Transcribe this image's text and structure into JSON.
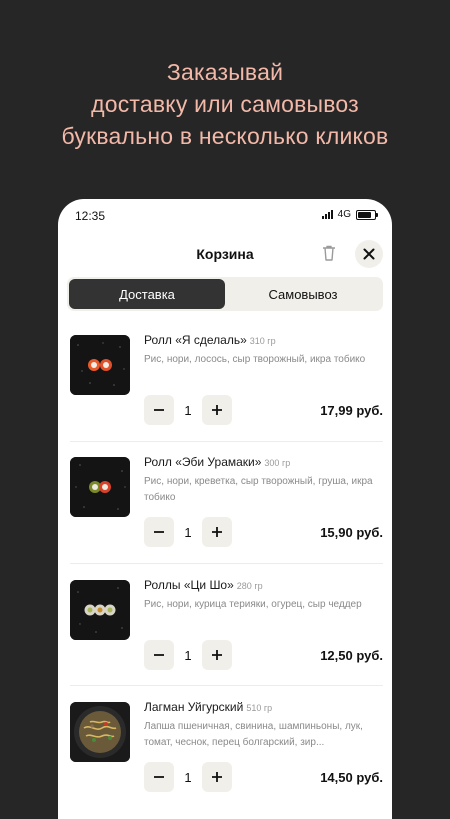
{
  "promo": {
    "line1": "Заказывай",
    "line2": "доставку или самовывоз",
    "line3": "буквально в несколько кликов",
    "color": "#f2b8a8"
  },
  "status_bar": {
    "time": "12:35",
    "network": "4G"
  },
  "cart": {
    "title": "Корзина",
    "icons": {
      "delete": "trash-icon",
      "close": "close-icon"
    },
    "tabs": [
      {
        "label": "Доставка",
        "active": true
      },
      {
        "label": "Самовывоз",
        "active": false
      }
    ],
    "items": [
      {
        "name": "Ролл «Я сделаль»",
        "weight": "310 гр",
        "description": "Рис, нори, лосось, сыр творожный, икра тобико",
        "quantity": "1",
        "price": "17,99 руб."
      },
      {
        "name": "Ролл «Эби Урамаки»",
        "weight": "300 гр",
        "description": "Рис, нори, креветка, сыр творожный, груша, икра тобико",
        "quantity": "1",
        "price": "15,90 руб."
      },
      {
        "name": "Роллы «Ци Шо»",
        "weight": "280 гр",
        "description": "Рис, нори, курица терияки, огурец, сыр чеддер",
        "quantity": "1",
        "price": "12,50 руб."
      },
      {
        "name": "Лагман Уйгурский",
        "weight": "510 гр",
        "description": "Лапша пшеничная, свинина, шампиньоны, лук, томат, чеснок, перец болгарский, зир...",
        "quantity": "1",
        "price": "14,50 руб."
      }
    ]
  }
}
